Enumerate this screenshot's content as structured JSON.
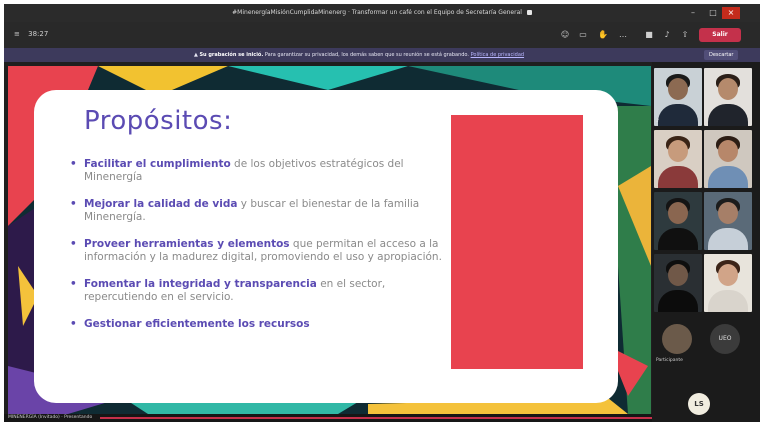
{
  "window": {
    "title": "#MinenergíaMisiónCumplidaMinenerg · Transformar un café con el Equipo de Secretaría General"
  },
  "toolbar": {
    "timer": "38:27",
    "leave_label": "Salir"
  },
  "banner": {
    "bold": "Su grabación se inició.",
    "message": "Para garantizar su privacidad, los demás saben que su reunión se está grabando.",
    "link": "Política de privacidad",
    "dismiss_label": "Descartar"
  },
  "slide": {
    "title": "Propósitos:",
    "items": [
      {
        "bullet": "•",
        "emphasis": "Facilitar el cumplimiento",
        "rest": " de los objetivos estratégicos del Minenergía"
      },
      {
        "bullet": "•",
        "emphasis": "Mejorar la calidad de vida",
        "rest": " y buscar el bienestar de la familia Minenergía."
      },
      {
        "bullet": "•",
        "emphasis": "Proveer herramientas y elementos",
        "rest": " que permitan el acceso a la información y la madurez digital, promoviendo el uso y apropiación."
      },
      {
        "bullet": "•",
        "emphasis": "Fomentar la integridad y transparencia",
        "rest": " en el sector, repercutiendo en el servicio."
      },
      {
        "bullet": "•",
        "emphasis": "Gestionar eficientemente los recursos",
        "rest": ""
      }
    ],
    "accent_color": "#e8434f",
    "title_color": "#5b4bb3"
  },
  "presenter": {
    "name": "MINENERGÍA (Invitado) · Presentando"
  },
  "participants": {
    "avatar_1_label": "Participante",
    "avatar_2_initials": "UEO",
    "self_initials": "LS"
  },
  "icons": [
    "video-icon",
    "people-icon",
    "chat-icon",
    "more-icon",
    "camera-icon",
    "mic-icon",
    "share-icon",
    "minimize-icon",
    "maximize-icon",
    "close-icon"
  ]
}
